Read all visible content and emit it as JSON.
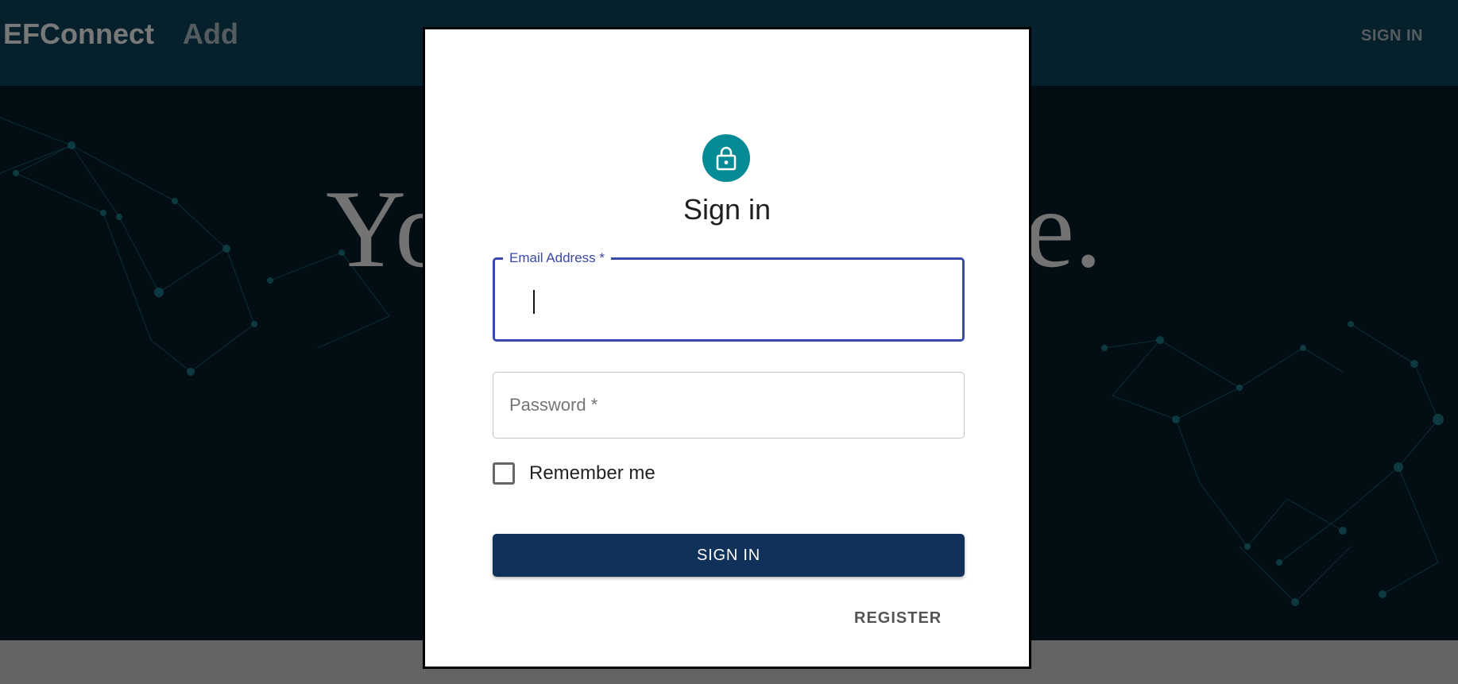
{
  "navbar": {
    "brand": "EFConnect",
    "add_label": "Add",
    "sign_in_label": "SIGN IN"
  },
  "hero": {
    "text_left": "Yo",
    "text_right": "e."
  },
  "dialog": {
    "title": "Sign in",
    "icon": "lock-icon",
    "email": {
      "label": "Email Address *",
      "value": ""
    },
    "password": {
      "placeholder": "Password *",
      "value": ""
    },
    "remember_label": "Remember me",
    "remember_checked": false,
    "submit_label": "SIGN IN",
    "register_label": "REGISTER"
  },
  "colors": {
    "accent": "#3849aa",
    "avatar": "#058b95",
    "button": "#10315a"
  }
}
